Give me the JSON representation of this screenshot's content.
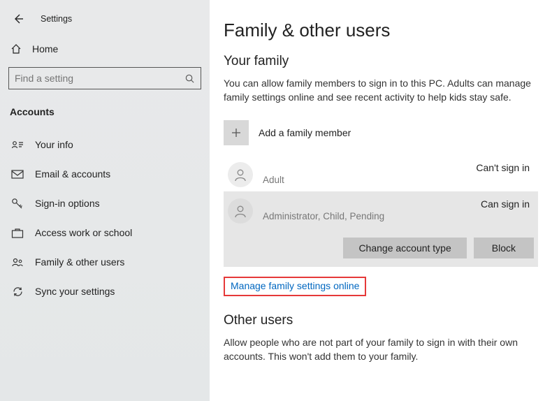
{
  "header": {
    "app_title": "Settings"
  },
  "sidebar": {
    "home_label": "Home",
    "search_placeholder": "Find a setting",
    "category": "Accounts",
    "items": [
      {
        "label": "Your info"
      },
      {
        "label": "Email & accounts"
      },
      {
        "label": "Sign-in options"
      },
      {
        "label": "Access work or school"
      },
      {
        "label": "Family & other users"
      },
      {
        "label": "Sync your settings"
      }
    ]
  },
  "main": {
    "title": "Family & other users",
    "family_heading": "Your family",
    "family_desc": "You can allow family members to sign in to this PC. Adults can manage family settings online and see recent activity to help kids stay safe.",
    "add_label": "Add a family member",
    "members": [
      {
        "name": "",
        "role": "Adult",
        "status": "Can't sign in"
      },
      {
        "name": "",
        "role": "Administrator, Child, Pending",
        "status": "Can sign in"
      }
    ],
    "change_btn": "Change account type",
    "block_btn": "Block",
    "manage_link": "Manage family settings online",
    "other_heading": "Other users",
    "other_desc": "Allow people who are not part of your family to sign in with their own accounts. This won't add them to your family."
  }
}
